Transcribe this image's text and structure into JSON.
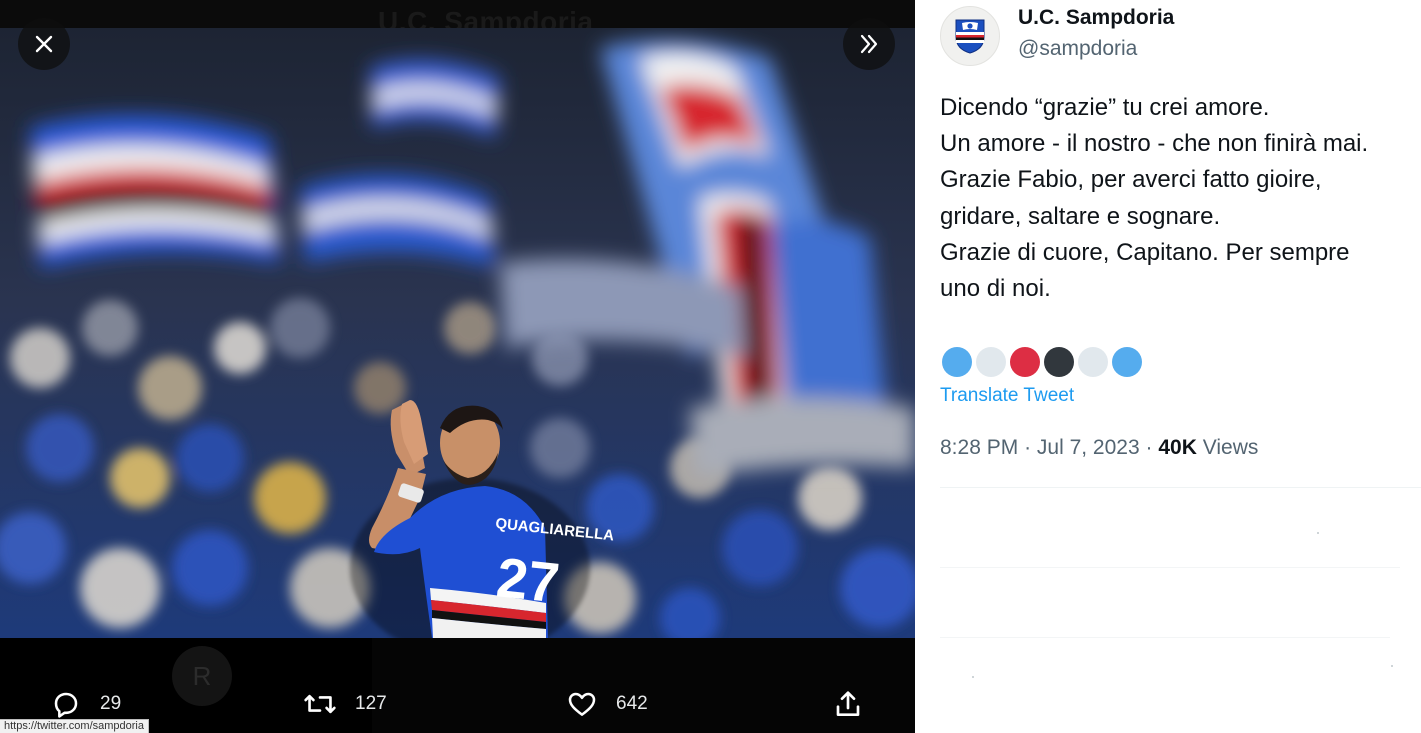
{
  "viewer": {
    "background_title": "U.C. Sampdoria",
    "ghost_avatar_letter": "R",
    "jersey_name": "QUAGLIARELLA",
    "jersey_number": "27",
    "close_icon": "close-icon",
    "expand_icon": "double-chevron-right-icon",
    "actions": {
      "reply": {
        "icon": "comment-icon",
        "count": "29"
      },
      "retweet": {
        "icon": "retweet-icon",
        "count": "127"
      },
      "like": {
        "icon": "heart-icon",
        "count": "642"
      },
      "share": {
        "icon": "share-icon"
      }
    },
    "status_url": "https://twitter.com/sampdoria"
  },
  "tweet": {
    "display_name": "U.C. Sampdoria",
    "handle": "@sampdoria",
    "lines": [
      "Dicendo “grazie” tu crei amore.",
      "Un amore - il nostro - che non finirà mai.",
      "Grazie Fabio, per averci fatto gioire,",
      "gridare, saltare e sognare.",
      "Grazie di cuore, Capitano. Per sempre",
      "uno di noi."
    ],
    "emoji_colors": [
      "#55acee",
      "#e1e8ed",
      "#dd2e44",
      "#31373d",
      "#e1e8ed",
      "#55acee"
    ],
    "translate_label": "Translate Tweet",
    "time": "8:28 PM",
    "separator": "·",
    "date": "Jul 7, 2023",
    "views_count": "40K",
    "views_label": "Views"
  },
  "colors": {
    "accent": "#1d9bf0",
    "sampdoria_blue": "#1b4fbf",
    "sampdoria_red": "#d7262e"
  }
}
